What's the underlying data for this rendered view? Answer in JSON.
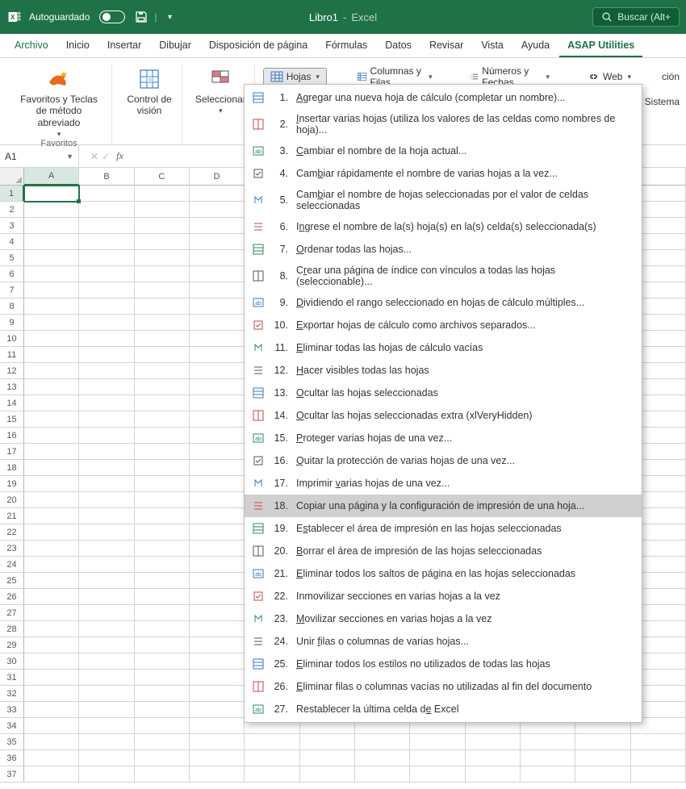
{
  "titlebar": {
    "autosave_label": "Autoguardado",
    "doc_name": "Libro1",
    "sep": "-",
    "app_name": "Excel",
    "search_placeholder": "Buscar (Alt+"
  },
  "tabs": {
    "file": "Archivo",
    "home": "Inicio",
    "insert": "Insertar",
    "draw": "Dibujar",
    "pagelayout": "Disposición de página",
    "formulas": "Fórmulas",
    "data": "Datos",
    "review": "Revisar",
    "view": "Vista",
    "help": "Ayuda",
    "asap": "ASAP Utilities"
  },
  "ribbon": {
    "favorites_btn": "Favoritos y Teclas de método abreviado",
    "favorites_group": "Favoritos",
    "vision_btn": "Control de visión",
    "select_btn": "Seleccionar",
    "hojas_btn": "Hojas",
    "cols_btn": "Columnas y Filas",
    "num_btn": "Números y Fechas",
    "web_btn": "Web",
    "right_text1": "ción",
    "right_text2": "y Sistema"
  },
  "formula_bar": {
    "name_box": "A1",
    "cancel": "✕",
    "confirm": "✓",
    "fx": "fx"
  },
  "grid": {
    "cols": [
      "A",
      "B",
      "C",
      "D"
    ],
    "rows": 37,
    "active_cell": "A1"
  },
  "menu": {
    "items": [
      {
        "n": "1.",
        "label": "Agregar una nueva hoja de cálculo (completar un nombre)...",
        "u": 0
      },
      {
        "n": "2.",
        "label": "Insertar varias hojas (utiliza los valores de las celdas como nombres de hoja)...",
        "u": 0
      },
      {
        "n": "3.",
        "label": "Cambiar el nombre de la hoja actual...",
        "u": 0
      },
      {
        "n": "4.",
        "label": "Cambiar rápidamente el nombre de varias hojas a la vez...",
        "u": 3
      },
      {
        "n": "5.",
        "label": "Cambiar el nombre de hojas seleccionadas por el valor de celdas seleccionadas",
        "u": 3
      },
      {
        "n": "6.",
        "label": "Ingrese el nombre de la(s) hoja(s) en la(s) celda(s) seleccionada(s)",
        "u": 1
      },
      {
        "n": "7.",
        "label": "Ordenar todas las hojas...",
        "u": 0
      },
      {
        "n": "8.",
        "label": "Crear una página de índice con vínculos a todas las hojas (seleccionable)...",
        "u": 1
      },
      {
        "n": "9.",
        "label": "Dividiendo el rango seleccionado en hojas de cálculo múltiples...",
        "u": 0
      },
      {
        "n": "10.",
        "label": "Exportar hojas de cálculo como archivos separados...",
        "u": 0
      },
      {
        "n": "11.",
        "label": "Eliminar todas las hojas de cálculo vacías",
        "u": 0
      },
      {
        "n": "12.",
        "label": "Hacer visibles todas las hojas",
        "u": 0
      },
      {
        "n": "13.",
        "label": "Ocultar las hojas seleccionadas",
        "u": 0
      },
      {
        "n": "14.",
        "label": "Ocultar las hojas seleccionadas extra (xlVeryHidden)",
        "u": 0
      },
      {
        "n": "15.",
        "label": "Proteger varias hojas de una vez...",
        "u": 0
      },
      {
        "n": "16.",
        "label": "Quitar la protección de varias hojas de una vez...",
        "u": 0
      },
      {
        "n": "17.",
        "label": "Imprimir varias hojas de una vez...",
        "u": 9
      },
      {
        "n": "18.",
        "label": "Copiar una página y la configuración de impresión de una hoja...",
        "hover": true
      },
      {
        "n": "19.",
        "label": "Establecer el área de impresión en las hojas seleccionadas",
        "u": 1
      },
      {
        "n": "20.",
        "label": "Borrar el área de impresión de las hojas seleccionadas",
        "u": 0
      },
      {
        "n": "21.",
        "label": "Eliminar todos los saltos de página en las hojas seleccionadas",
        "u": 0
      },
      {
        "n": "22.",
        "label": "Inmovilizar secciones en varias hojas a la vez"
      },
      {
        "n": "23.",
        "label": "Movilizar secciones en varias hojas a la vez",
        "u": 0
      },
      {
        "n": "24.",
        "label": "Unir filas o columnas de varias hojas...",
        "u": 5
      },
      {
        "n": "25.",
        "label": "Eliminar todos los estilos no utilizados de todas las hojas",
        "u": 0
      },
      {
        "n": "26.",
        "label": "Eliminar filas o columnas vacías no utilizadas al fin del documento",
        "u": 0
      },
      {
        "n": "27.",
        "label": "Restablecer la última celda de Excel",
        "u": 29
      }
    ]
  }
}
